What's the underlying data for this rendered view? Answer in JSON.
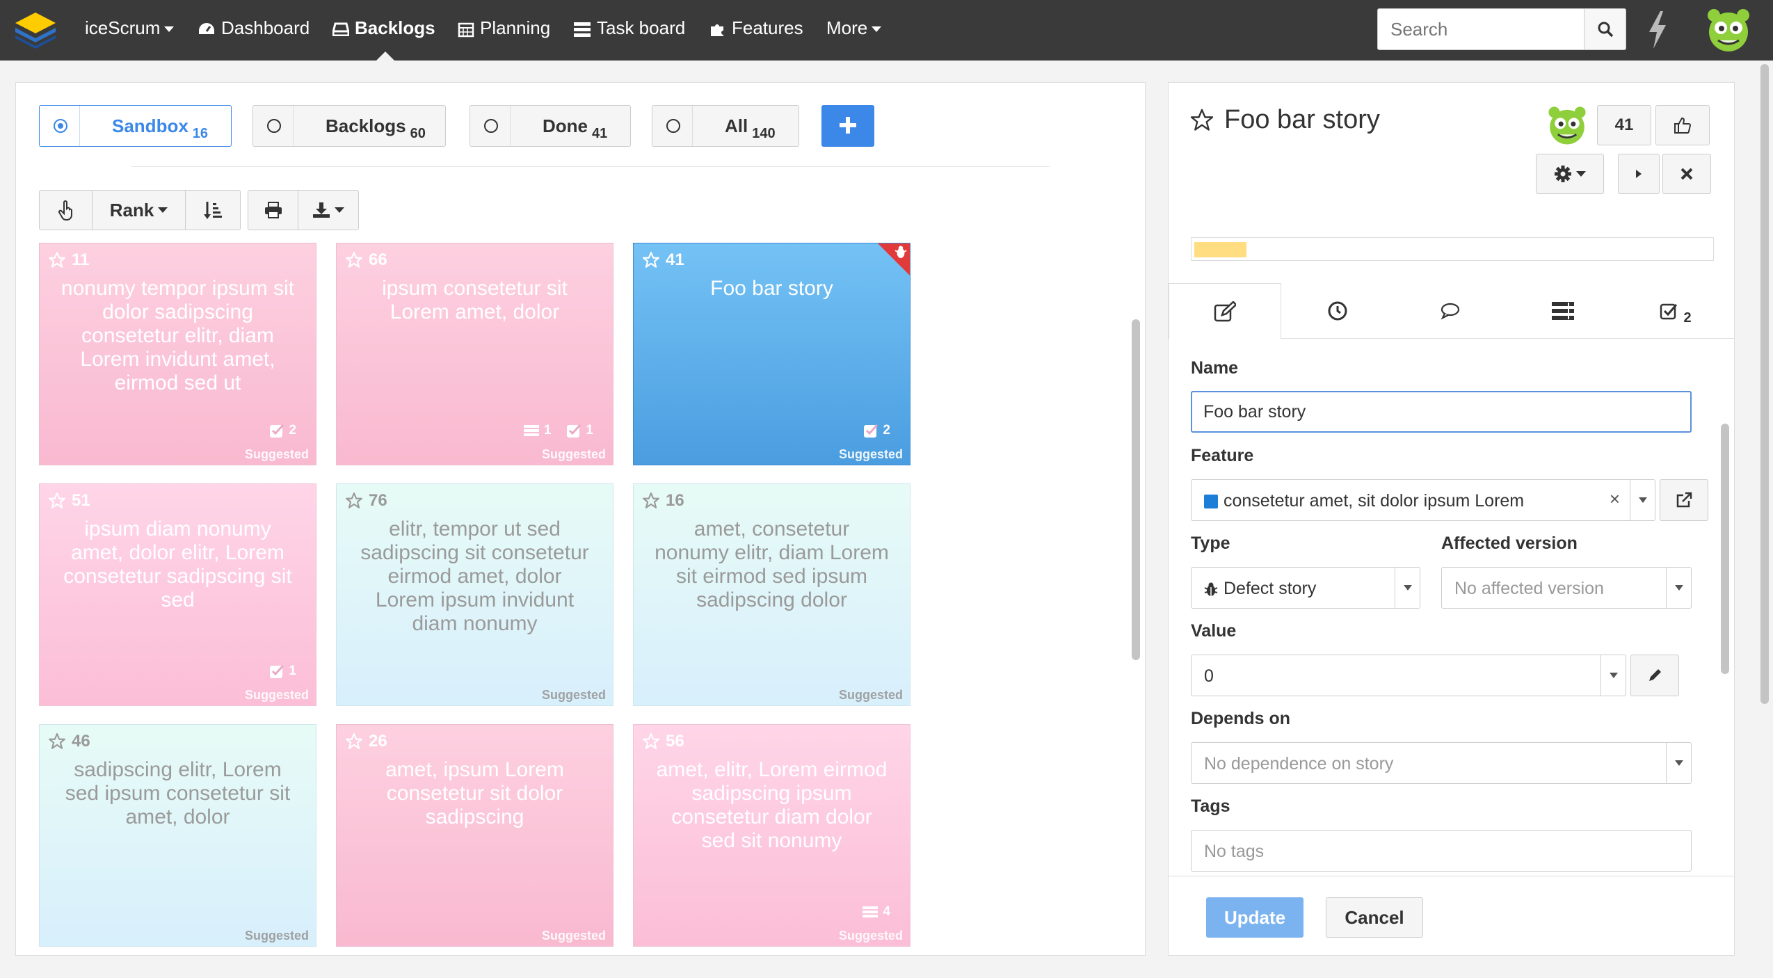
{
  "nav": {
    "brand": "iceScrum",
    "items": [
      {
        "label": "Dashboard",
        "icon": "dashboard-icon"
      },
      {
        "label": "Backlogs",
        "icon": "backlogs-icon",
        "active": true
      },
      {
        "label": "Planning",
        "icon": "calendar-icon"
      },
      {
        "label": "Task board",
        "icon": "taskboard-icon"
      },
      {
        "label": "Features",
        "icon": "puzzle-icon"
      }
    ],
    "more": "More",
    "search_placeholder": "Search"
  },
  "backlog_tabs": [
    {
      "label": "Sandbox",
      "count": "16",
      "active": true
    },
    {
      "label": "Backlogs",
      "count": "60"
    },
    {
      "label": "Done",
      "count": "41"
    },
    {
      "label": "All",
      "count": "140"
    }
  ],
  "toolbar": {
    "sort_label": "Rank"
  },
  "cards": [
    {
      "id": "11",
      "text": "nonumy tempor ipsum sit dolor sadipscing consetetur elitr, diam Lorem invidunt amet, eirmod sed ut",
      "tasks": "2",
      "state": "Suggested",
      "color": "pink"
    },
    {
      "id": "66",
      "text": "ipsum consetetur sit Lorem amet, dolor",
      "acceptance": "1",
      "tasks": "1",
      "state": "Suggested",
      "color": "pink"
    },
    {
      "id": "41",
      "text": "Foo bar story",
      "tasks": "2",
      "state": "Suggested",
      "color": "blue",
      "defect": true
    },
    {
      "id": "51",
      "text": "ipsum diam nonumy amet, dolor elitr, Lorem consetetur sadipscing sit sed",
      "tasks": "1",
      "state": "Suggested",
      "color": "lightpink"
    },
    {
      "id": "76",
      "text": "elitr, tempor ut sed sadipscing sit consetetur eirmod amet, dolor Lorem ipsum invidunt diam nonumy",
      "state": "Suggested",
      "color": "mint"
    },
    {
      "id": "16",
      "text": "amet, consetetur nonumy elitr, diam Lorem sit eirmod sed ipsum sadipscing dolor",
      "state": "Suggested",
      "color": "mint"
    },
    {
      "id": "46",
      "text": "sadipscing elitr, Lorem sed ipsum consetetur sit amet, dolor",
      "state": "Suggested",
      "color": "mint"
    },
    {
      "id": "26",
      "text": "amet, ipsum Lorem consetetur sit dolor sadipscing",
      "state": "Suggested",
      "color": "pink"
    },
    {
      "id": "56",
      "text": "amet, elitr, Lorem eirmod sadipscing ipsum consetetur diam dolor sed sit nonumy",
      "acceptance": "4",
      "state": "Suggested",
      "color": "lightpink"
    }
  ],
  "detail": {
    "title": "Foo bar story",
    "votes": "41",
    "progress": 0.1,
    "tab_task_count": "2",
    "name_label": "Name",
    "name_value": "Foo bar story",
    "feature_label": "Feature",
    "feature_value": "consetetur amet, sit dolor ipsum Lorem",
    "feature_color": "#1c7ed6",
    "type_label": "Type",
    "type_value": "Defect story",
    "affected_label": "Affected version",
    "affected_placeholder": "No affected version",
    "value_label": "Value",
    "value_value": "0",
    "depends_label": "Depends on",
    "depends_placeholder": "No dependence on story",
    "tags_label": "Tags",
    "tags_placeholder": "No tags",
    "update_label": "Update",
    "cancel_label": "Cancel",
    "clear_symbol": "×"
  }
}
